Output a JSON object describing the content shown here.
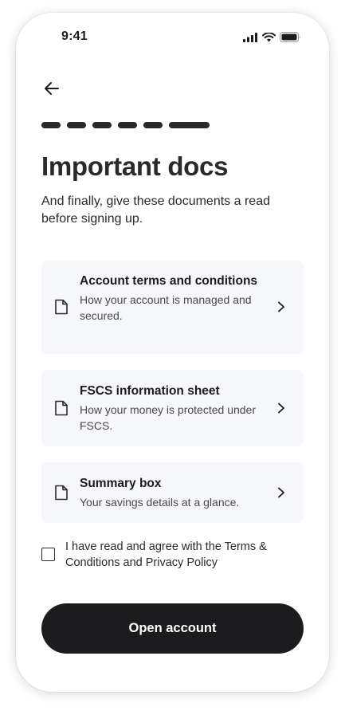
{
  "status_bar": {
    "time": "9:41",
    "icons": [
      "cellular-signal-icon",
      "wifi-icon",
      "battery-icon"
    ]
  },
  "nav": {
    "back_icon": "arrow-left-icon"
  },
  "progress": {
    "total_steps": 6,
    "current_step": 6
  },
  "header": {
    "title": "Important docs",
    "subtitle": "And finally, give these documents a read before signing up."
  },
  "documents": [
    {
      "title": "Account terms and conditions",
      "description": "How your account is managed and secured.",
      "icon": "document-icon",
      "chevron": "chevron-right-icon"
    },
    {
      "title": "FSCS information sheet",
      "description": "How your money is protected under FSCS.",
      "icon": "document-icon",
      "chevron": "chevron-right-icon"
    },
    {
      "title": "Summary box",
      "description": "Your savings details at a glance.",
      "icon": "document-icon",
      "chevron": "chevron-right-icon"
    }
  ],
  "agreement": {
    "checked": false,
    "label": "I have read and agree with the Terms & Conditions and Privacy Policy"
  },
  "cta": {
    "label": "Open account"
  },
  "colors": {
    "text": "#1c1b1d",
    "card_background": "#f6f7fb",
    "button_background": "#1c1b1d",
    "button_text": "#ffffff"
  }
}
